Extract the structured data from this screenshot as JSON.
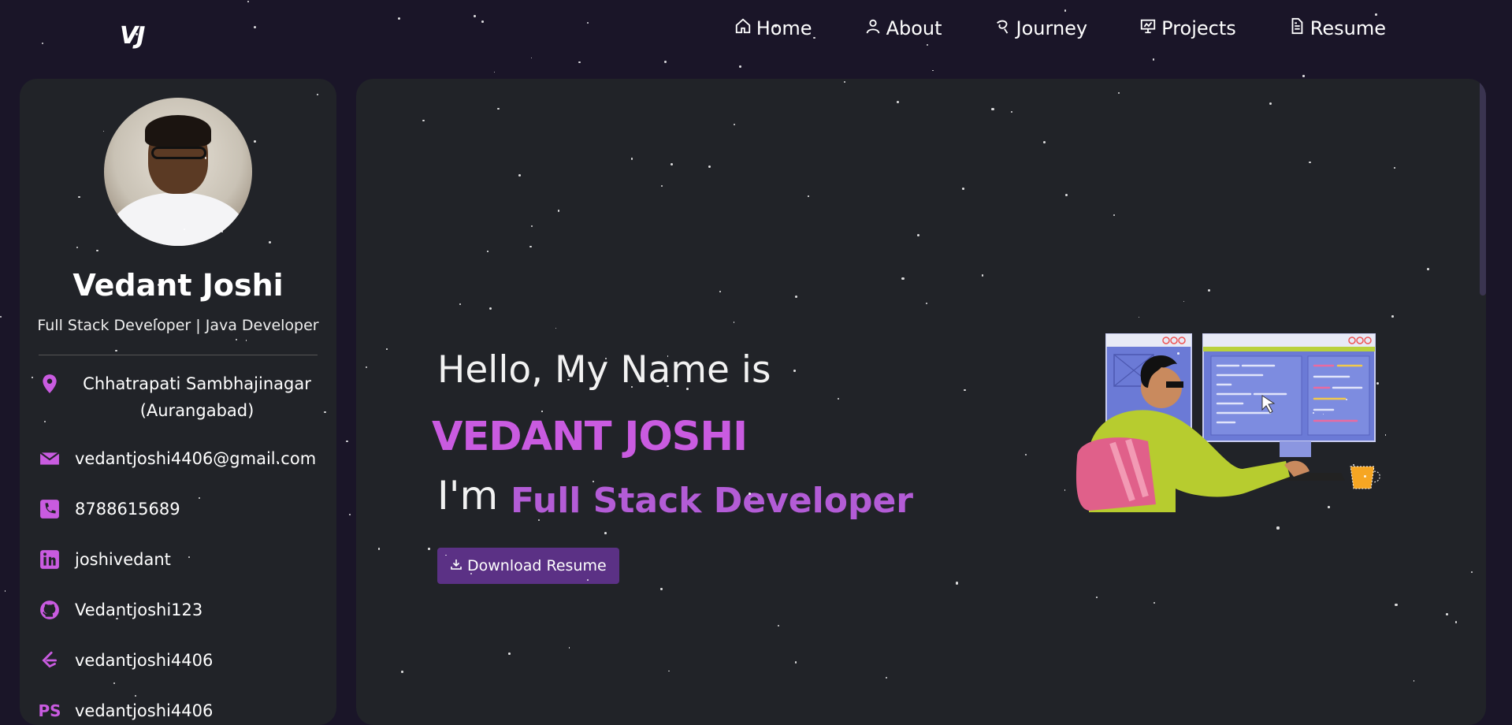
{
  "nav": {
    "logo": "VJ",
    "items": [
      {
        "label": "Home",
        "icon": "home-icon"
      },
      {
        "label": "About",
        "icon": "user-icon"
      },
      {
        "label": "Journey",
        "icon": "journey-icon"
      },
      {
        "label": "Projects",
        "icon": "presentation-icon"
      },
      {
        "label": "Resume",
        "icon": "document-icon"
      }
    ]
  },
  "sidebar": {
    "name": "Vedant Joshi",
    "role": "Full Stack Developer | Java Developer",
    "location_line1": "Chhatrapati Sambhajinagar",
    "location_line2": "(Aurangabad)",
    "email": "vedantjoshi4406@gmail.com",
    "phone": "8788615689",
    "linkedin": "joshivedant",
    "github": "Vedantjoshi123",
    "leetcode": "vedantjoshi4406",
    "partial_next": "vedantjoshi4406"
  },
  "hero": {
    "greeting": "Hello, My Name is",
    "name": "VEDANT JOSHI",
    "im": "I'm",
    "role": "Full Stack Developer",
    "download_label": "Download Resume"
  },
  "colors": {
    "background": "#1a1528",
    "card": "#212328",
    "accent": "#c95be0",
    "button": "#5b3185"
  }
}
